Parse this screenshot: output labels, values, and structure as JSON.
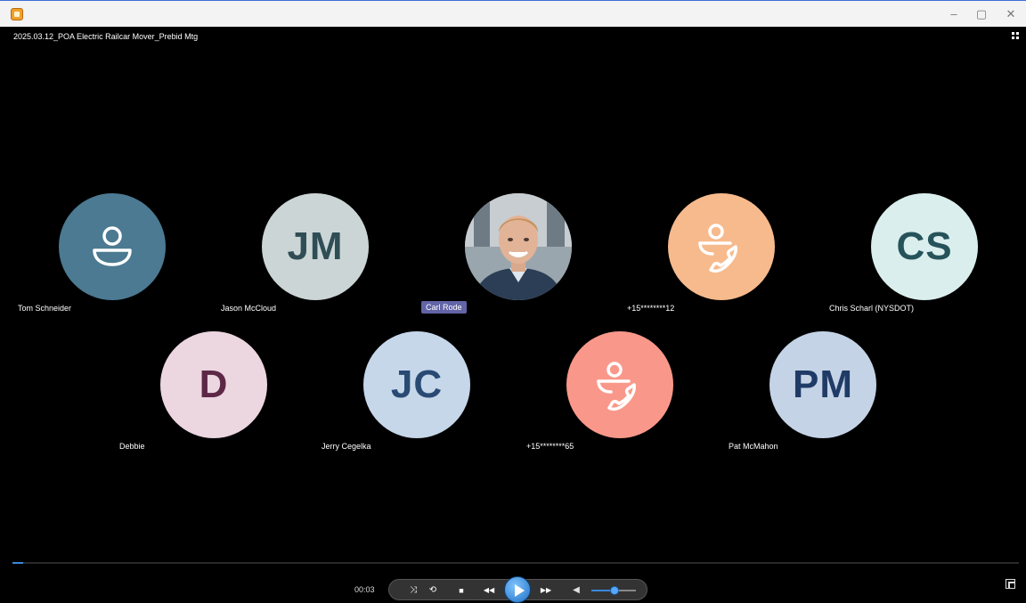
{
  "window": {
    "minimize": "–",
    "maximize": "▢",
    "close": "✕"
  },
  "video": {
    "title": "2025.03.12_POA Electric Railcar Mover_Prebid Mtg"
  },
  "participants": [
    {
      "name": "Tom Schneider",
      "initials": "",
      "icon": "person-icon",
      "color": "#4b7a92",
      "fg": "#ffffff",
      "active": false
    },
    {
      "name": "Jason McCloud",
      "initials": "JM",
      "icon": "",
      "color": "#ccd5d6",
      "fg": "#2f4d55",
      "active": false
    },
    {
      "name": "Carl Rode",
      "initials": "",
      "icon": "photo",
      "color": "#6f7f8a",
      "fg": "#ffffff",
      "active": true
    },
    {
      "name": "+15********12",
      "initials": "",
      "icon": "phone-person-icon",
      "color": "#f7ba8d",
      "fg": "#ffffff",
      "active": false
    },
    {
      "name": "Chris Scharl (NYSDOT)",
      "initials": "CS",
      "icon": "",
      "color": "#dbeeee",
      "fg": "#26535a",
      "active": false
    },
    {
      "name": "Debbie",
      "initials": "D",
      "icon": "",
      "color": "#ecd6e0",
      "fg": "#5c2846",
      "active": false
    },
    {
      "name": "Jerry Cegelka",
      "initials": "JC",
      "icon": "",
      "color": "#c7d7ea",
      "fg": "#284a73",
      "active": false
    },
    {
      "name": "+15********65",
      "initials": "",
      "icon": "phone-person-icon",
      "color": "#f9988a",
      "fg": "#ffffff",
      "active": false
    },
    {
      "name": "Pat McMahon",
      "initials": "PM",
      "icon": "",
      "color": "#c5d3e6",
      "fg": "#1f3b66",
      "active": false
    }
  ],
  "player": {
    "time": "00:03",
    "progress_fraction": 0.011,
    "volume_fraction": 0.52,
    "buttons": {
      "shuffle": "⤨",
      "repeat": "⟲",
      "stop": "■",
      "prev": "◀◀",
      "next": "▶▶",
      "mute": "◀"
    }
  },
  "colors": {
    "accent": "#3a86d9",
    "active_name": "#6264a7"
  }
}
